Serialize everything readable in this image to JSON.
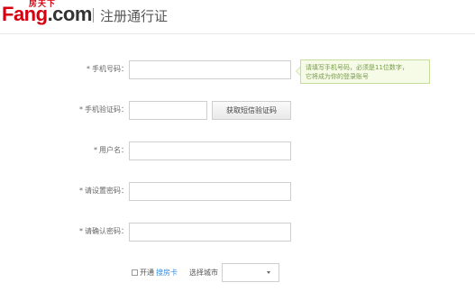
{
  "header": {
    "logo_cn": "房天下",
    "logo_main": "Fang",
    "logo_suffix": ".com",
    "title": "注册通行证"
  },
  "form": {
    "phone": {
      "label": "手机号码：",
      "required": "*",
      "value": ""
    },
    "code": {
      "label": "手机验证码：",
      "required": "*",
      "value": "",
      "button_label": "获取短信验证码"
    },
    "username": {
      "label": "用户名：",
      "required": "*",
      "value": ""
    },
    "password": {
      "label": "请设置密码：",
      "required": "*",
      "value": ""
    },
    "confirm": {
      "label": "请确认密码：",
      "required": "*",
      "value": ""
    }
  },
  "tooltip": {
    "line1": "请填写手机号码，必须是11位数字，",
    "line2": "它将成为你的登录账号"
  },
  "bottom": {
    "open_text": "开通",
    "card_link": "搜房卡",
    "city_label": "选择城市",
    "city_value": ""
  },
  "colors": {
    "brand_red": "#d7000f",
    "tooltip_bg": "#f5fbe6",
    "tooltip_border": "#c6dd9c",
    "link_blue": "#3a8ede"
  }
}
